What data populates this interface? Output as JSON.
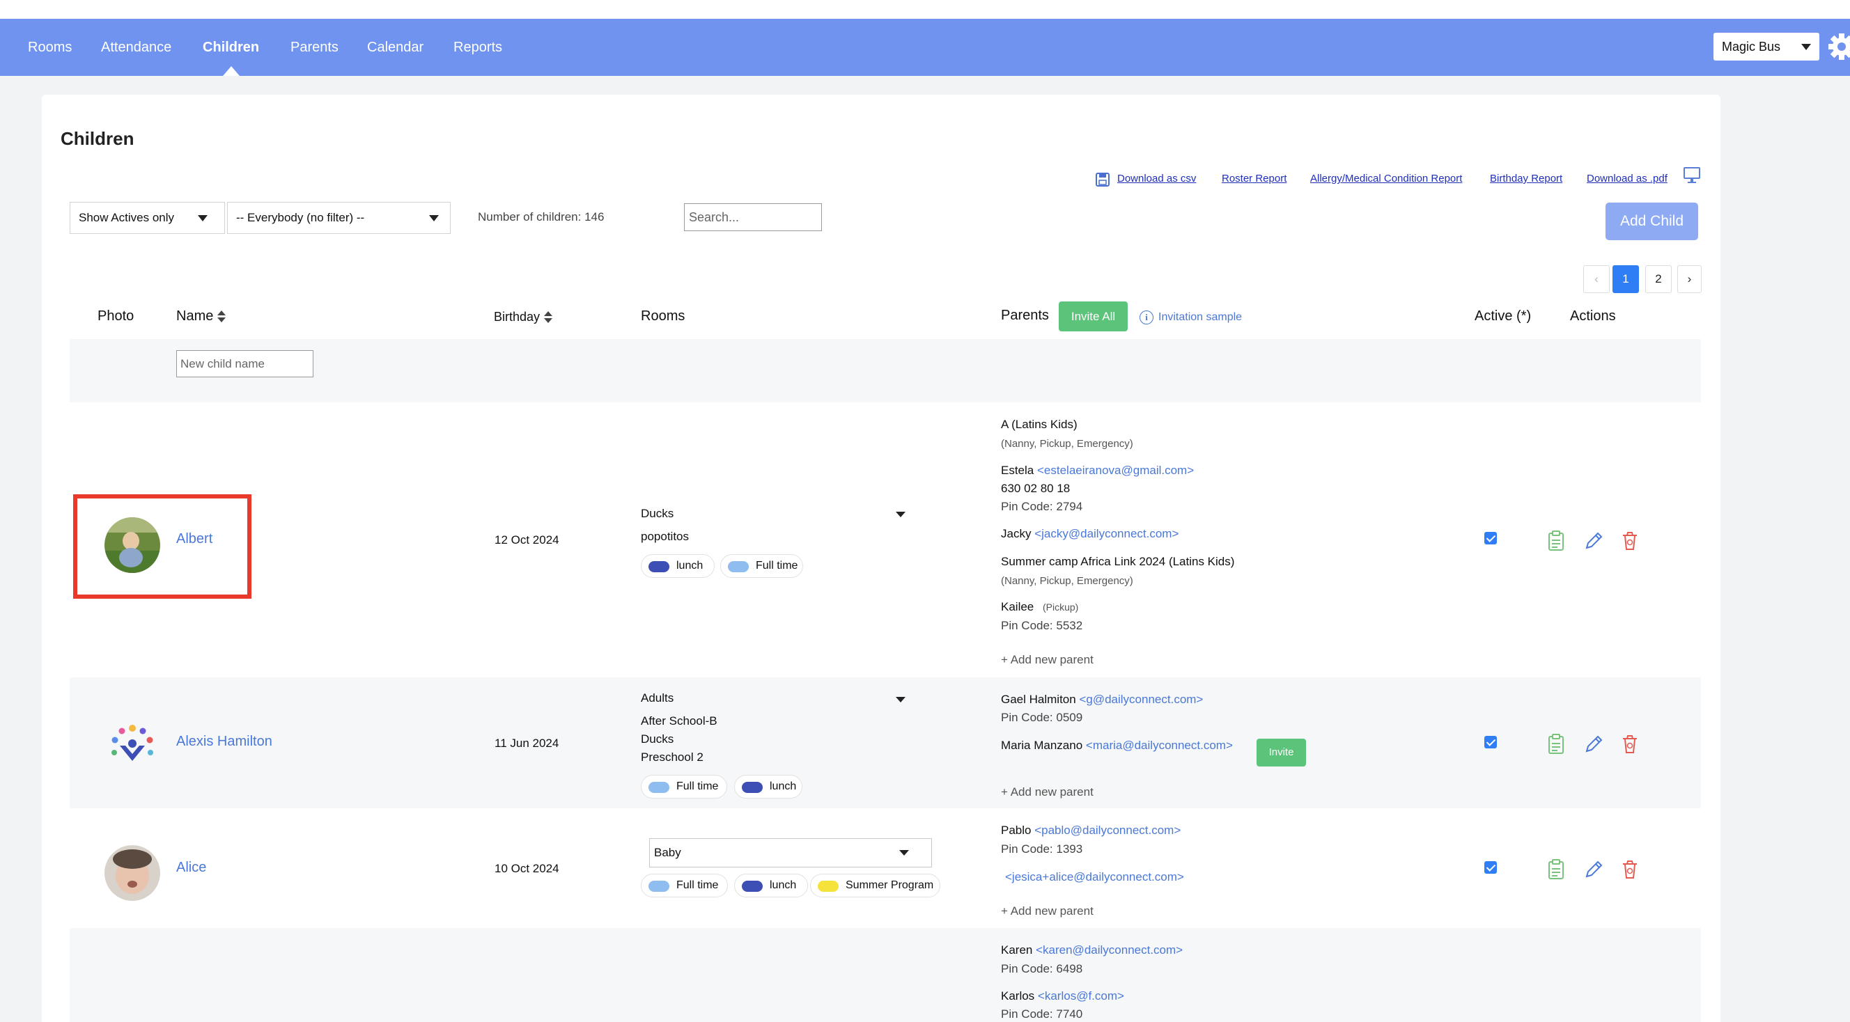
{
  "nav": {
    "items": [
      "Rooms",
      "Attendance",
      "Children",
      "Parents",
      "Calendar",
      "Reports"
    ],
    "active": "Children",
    "school_select": "Magic Bus"
  },
  "page": {
    "title": "Children",
    "export_links": [
      "Download as csv",
      "Roster Report",
      "Allergy/Medical Condition Report",
      "Birthday Report",
      "Download as .pdf"
    ],
    "filters": {
      "status": "Show Actives only",
      "group": "-- Everybody (no filter) --"
    },
    "count_text": "Number of children: 146",
    "search_placeholder": "Search...",
    "add_child": "Add Child",
    "pagination": [
      "‹",
      "1",
      "2",
      "›"
    ]
  },
  "table": {
    "headers": {
      "photo": "Photo",
      "name": "Name",
      "birthday": "Birthday",
      "rooms": "Rooms",
      "parents": "Parents",
      "invite_all": "Invite All",
      "invitation_sample": "Invitation sample",
      "active": "Active (*)",
      "actions": "Actions"
    },
    "new_child_placeholder": "New child name",
    "rows": [
      {
        "name": "Albert",
        "birthday": "12 Oct 2024",
        "rooms": [
          "Ducks",
          "popotitos"
        ],
        "tags": [
          "lunch",
          "Full time"
        ],
        "parents": {
          "p1": "A (Latins Kids)",
          "p1_roles": "(Nanny, Pickup, Emergency)",
          "p2": "Estela",
          "p2_email": "<estelaeiranova@gmail.com>",
          "p2_phone": "630 02 80 18",
          "p2_pin": "Pin Code: 2794",
          "p3": "Jacky",
          "p3_email": "<jacky@dailyconnect.com>",
          "p4": "Summer camp Africa Link 2024 (Latins Kids)",
          "p4_roles": "(Nanny, Pickup, Emergency)",
          "p5": "Kailee",
          "p5_roles": "(Pickup)",
          "p5_pin": "Pin Code: 5532"
        },
        "add_parent": "Add new parent"
      },
      {
        "name": "Alexis Hamilton",
        "birthday": "11 Jun 2024",
        "rooms": [
          "Adults",
          "After School-B",
          "Ducks",
          "Preschool 2"
        ],
        "tags": [
          "Full time",
          "lunch"
        ],
        "parents": {
          "p1": "Gael Halmiton",
          "p1_email": "<g@dailyconnect.com>",
          "p1_pin": "Pin Code: 0509",
          "p2": "Maria Manzano",
          "p2_email": "<maria@dailyconnect.com>",
          "invite": "Invite"
        },
        "add_parent": "Add new parent"
      },
      {
        "name": "Alice",
        "birthday": "10 Oct 2024",
        "room_select": "Baby",
        "tags": [
          "Full time",
          "lunch",
          "Summer Program"
        ],
        "parents": {
          "p1": "Pablo",
          "p1_email": "<pablo@dailyconnect.com>",
          "p1_pin": "Pin Code: 1393",
          "p2_email": "<jesica+alice@dailyconnect.com>"
        },
        "add_parent": "Add new parent"
      },
      {
        "parents": {
          "p1": "Karen",
          "p1_email": "<karen@dailyconnect.com>",
          "p1_pin": "Pin Code: 6498",
          "p2": "Karlos",
          "p2_email": "<karlos@f.com>",
          "p2_pin": "Pin Code: 7740"
        }
      }
    ]
  },
  "colors": {
    "nav_bg": "#6f93ef",
    "link": "#4a78d8",
    "invite_green": "#5bc37a",
    "tag_lunch": "#3d4fb5",
    "tag_fulltime": "#8fbdf0",
    "tag_summer": "#f5e23a",
    "highlight": "#e8392a"
  }
}
